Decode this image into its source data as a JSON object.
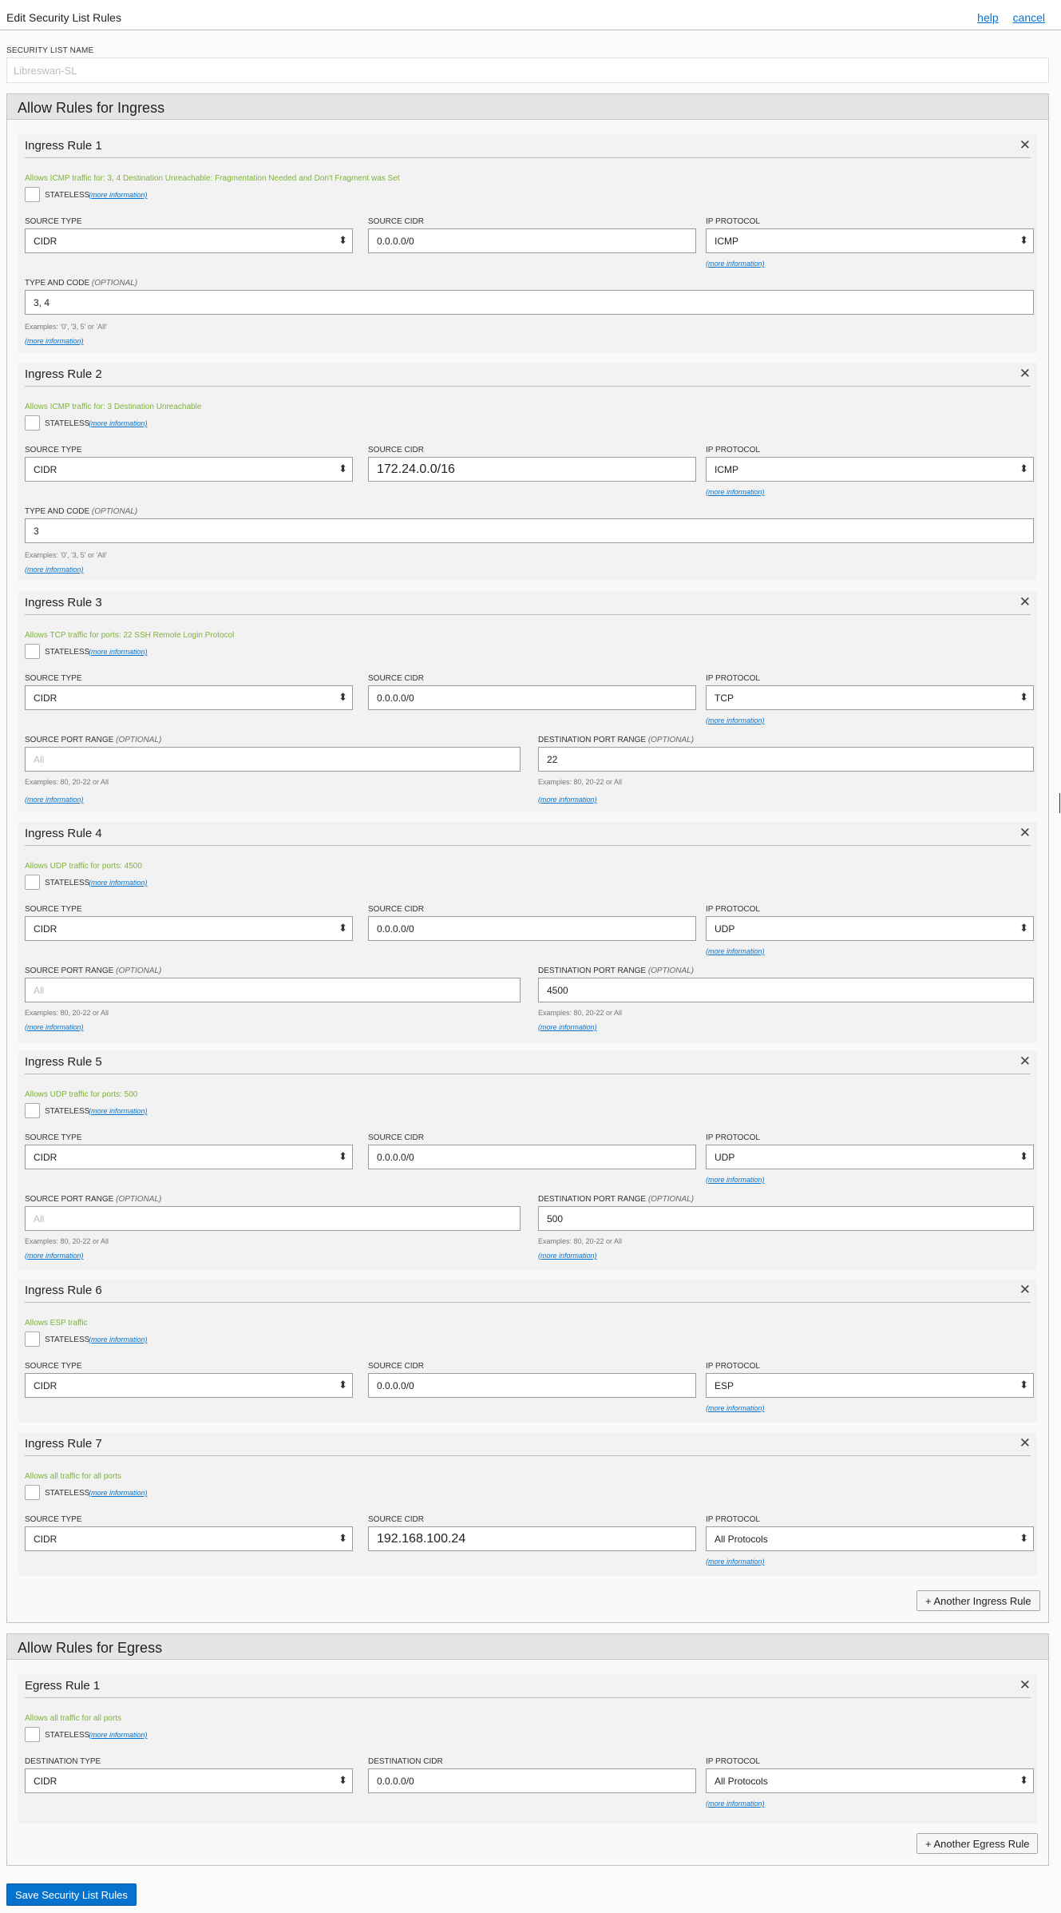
{
  "header": {
    "title": "Edit Security List Rules",
    "help": "help",
    "cancel": "cancel"
  },
  "security_list": {
    "label": "SECURITY LIST NAME",
    "placeholder": "Libreswan-SL"
  },
  "common": {
    "stateless": "STATELESS",
    "more_info": "(more information)",
    "source_type_label": "SOURCE TYPE",
    "source_cidr_label": "SOURCE CIDR",
    "ip_protocol_label": "IP PROTOCOL",
    "type_code_label": "TYPE AND CODE",
    "source_port_label": "SOURCE PORT RANGE",
    "dest_port_label": "DESTINATION PORT RANGE",
    "optional": "(OPTIONAL)",
    "type_code_hint": "Examples: '0', '3, 5' or 'All'",
    "port_hint": "Examples: 80, 20-22 or All",
    "port_placeholder": "All",
    "dest_type_label": "DESTINATION TYPE",
    "dest_cidr_label": "DESTINATION CIDR"
  },
  "ingress": {
    "heading": "Allow Rules for Ingress",
    "add_button": "+ Another Ingress Rule",
    "rules": [
      {
        "title": "Ingress Rule 1",
        "desc": "Allows ICMP traffic for: 3, 4 Destination Unreachable: Fragmentation Needed and Don't Fragment was Set",
        "source_type": "CIDR",
        "source_cidr": "0.0.0.0/0",
        "protocol": "ICMP",
        "type_code": "3, 4"
      },
      {
        "title": "Ingress Rule 2",
        "desc": "Allows ICMP traffic for: 3 Destination Unreachable",
        "source_type": "CIDR",
        "source_cidr": "172.24.0.0/16",
        "protocol": "ICMP",
        "type_code": "3"
      },
      {
        "title": "Ingress Rule 3",
        "desc": "Allows TCP traffic for ports: 22 SSH Remote Login Protocol",
        "source_type": "CIDR",
        "source_cidr": "0.0.0.0/0",
        "protocol": "TCP",
        "dest_port": "22"
      },
      {
        "title": "Ingress Rule 4",
        "desc": "Allows UDP traffic for ports: 4500",
        "source_type": "CIDR",
        "source_cidr": "0.0.0.0/0",
        "protocol": "UDP",
        "dest_port": "4500"
      },
      {
        "title": "Ingress Rule 5",
        "desc": "Allows UDP traffic for ports: 500",
        "source_type": "CIDR",
        "source_cidr": "0.0.0.0/0",
        "protocol": "UDP",
        "dest_port": "500"
      },
      {
        "title": "Ingress Rule 6",
        "desc": "Allows ESP traffic",
        "source_type": "CIDR",
        "source_cidr": "0.0.0.0/0",
        "protocol": "ESP"
      },
      {
        "title": "Ingress Rule 7",
        "desc": "Allows all traffic for all ports",
        "source_type": "CIDR",
        "source_cidr": "192.168.100.24",
        "protocol": "All Protocols"
      }
    ]
  },
  "egress": {
    "heading": "Allow Rules for Egress",
    "add_button": "+ Another Egress Rule",
    "rules": [
      {
        "title": "Egress Rule 1",
        "desc": "Allows all traffic for all ports",
        "dest_type": "CIDR",
        "dest_cidr": "0.0.0.0/0",
        "protocol": "All Protocols"
      }
    ]
  },
  "save_button": "Save Security List Rules"
}
